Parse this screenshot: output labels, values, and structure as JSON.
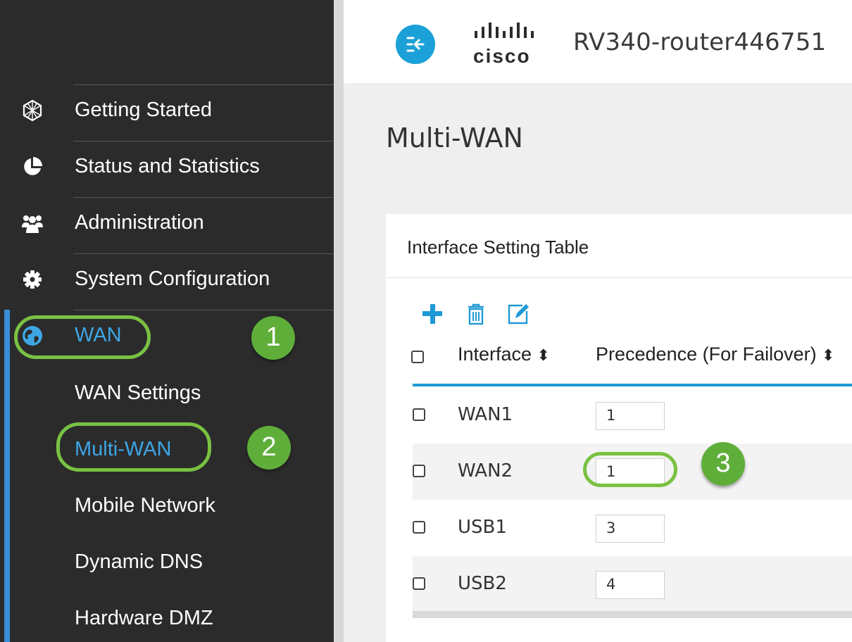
{
  "sidebar": {
    "items": [
      {
        "label": "Getting Started",
        "icon": "globe-mesh-icon"
      },
      {
        "label": "Status and Statistics",
        "icon": "pie-chart-icon"
      },
      {
        "label": "Administration",
        "icon": "users-icon"
      },
      {
        "label": "System Configuration",
        "icon": "gear-icon"
      },
      {
        "label": "WAN",
        "icon": "globe-icon",
        "active": true
      }
    ],
    "wan_subitems": [
      {
        "label": "WAN Settings"
      },
      {
        "label": "Multi-WAN",
        "active": true
      },
      {
        "label": "Mobile Network"
      },
      {
        "label": "Dynamic DNS"
      },
      {
        "label": "Hardware DMZ"
      }
    ],
    "accent_color": "#3ea6e5"
  },
  "header": {
    "brand": "cisco",
    "device_name": "RV340-router446751",
    "menu_button_icon": "collapse-arrow-icon"
  },
  "page": {
    "title": "Multi-WAN"
  },
  "table": {
    "title": "Interface Setting Table",
    "toolbar": [
      "add-icon",
      "trash-icon",
      "edit-icon"
    ],
    "columns": [
      "Interface",
      "Precedence (For Failover)"
    ],
    "sort_glyph": "⬍",
    "rows": [
      {
        "interface": "WAN1",
        "precedence": "1"
      },
      {
        "interface": "WAN2",
        "precedence": "1"
      },
      {
        "interface": "USB1",
        "precedence": "3"
      },
      {
        "interface": "USB2",
        "precedence": "4"
      }
    ]
  },
  "annotations": {
    "steps": [
      "1",
      "2",
      "3"
    ],
    "color": "#7ac142"
  }
}
